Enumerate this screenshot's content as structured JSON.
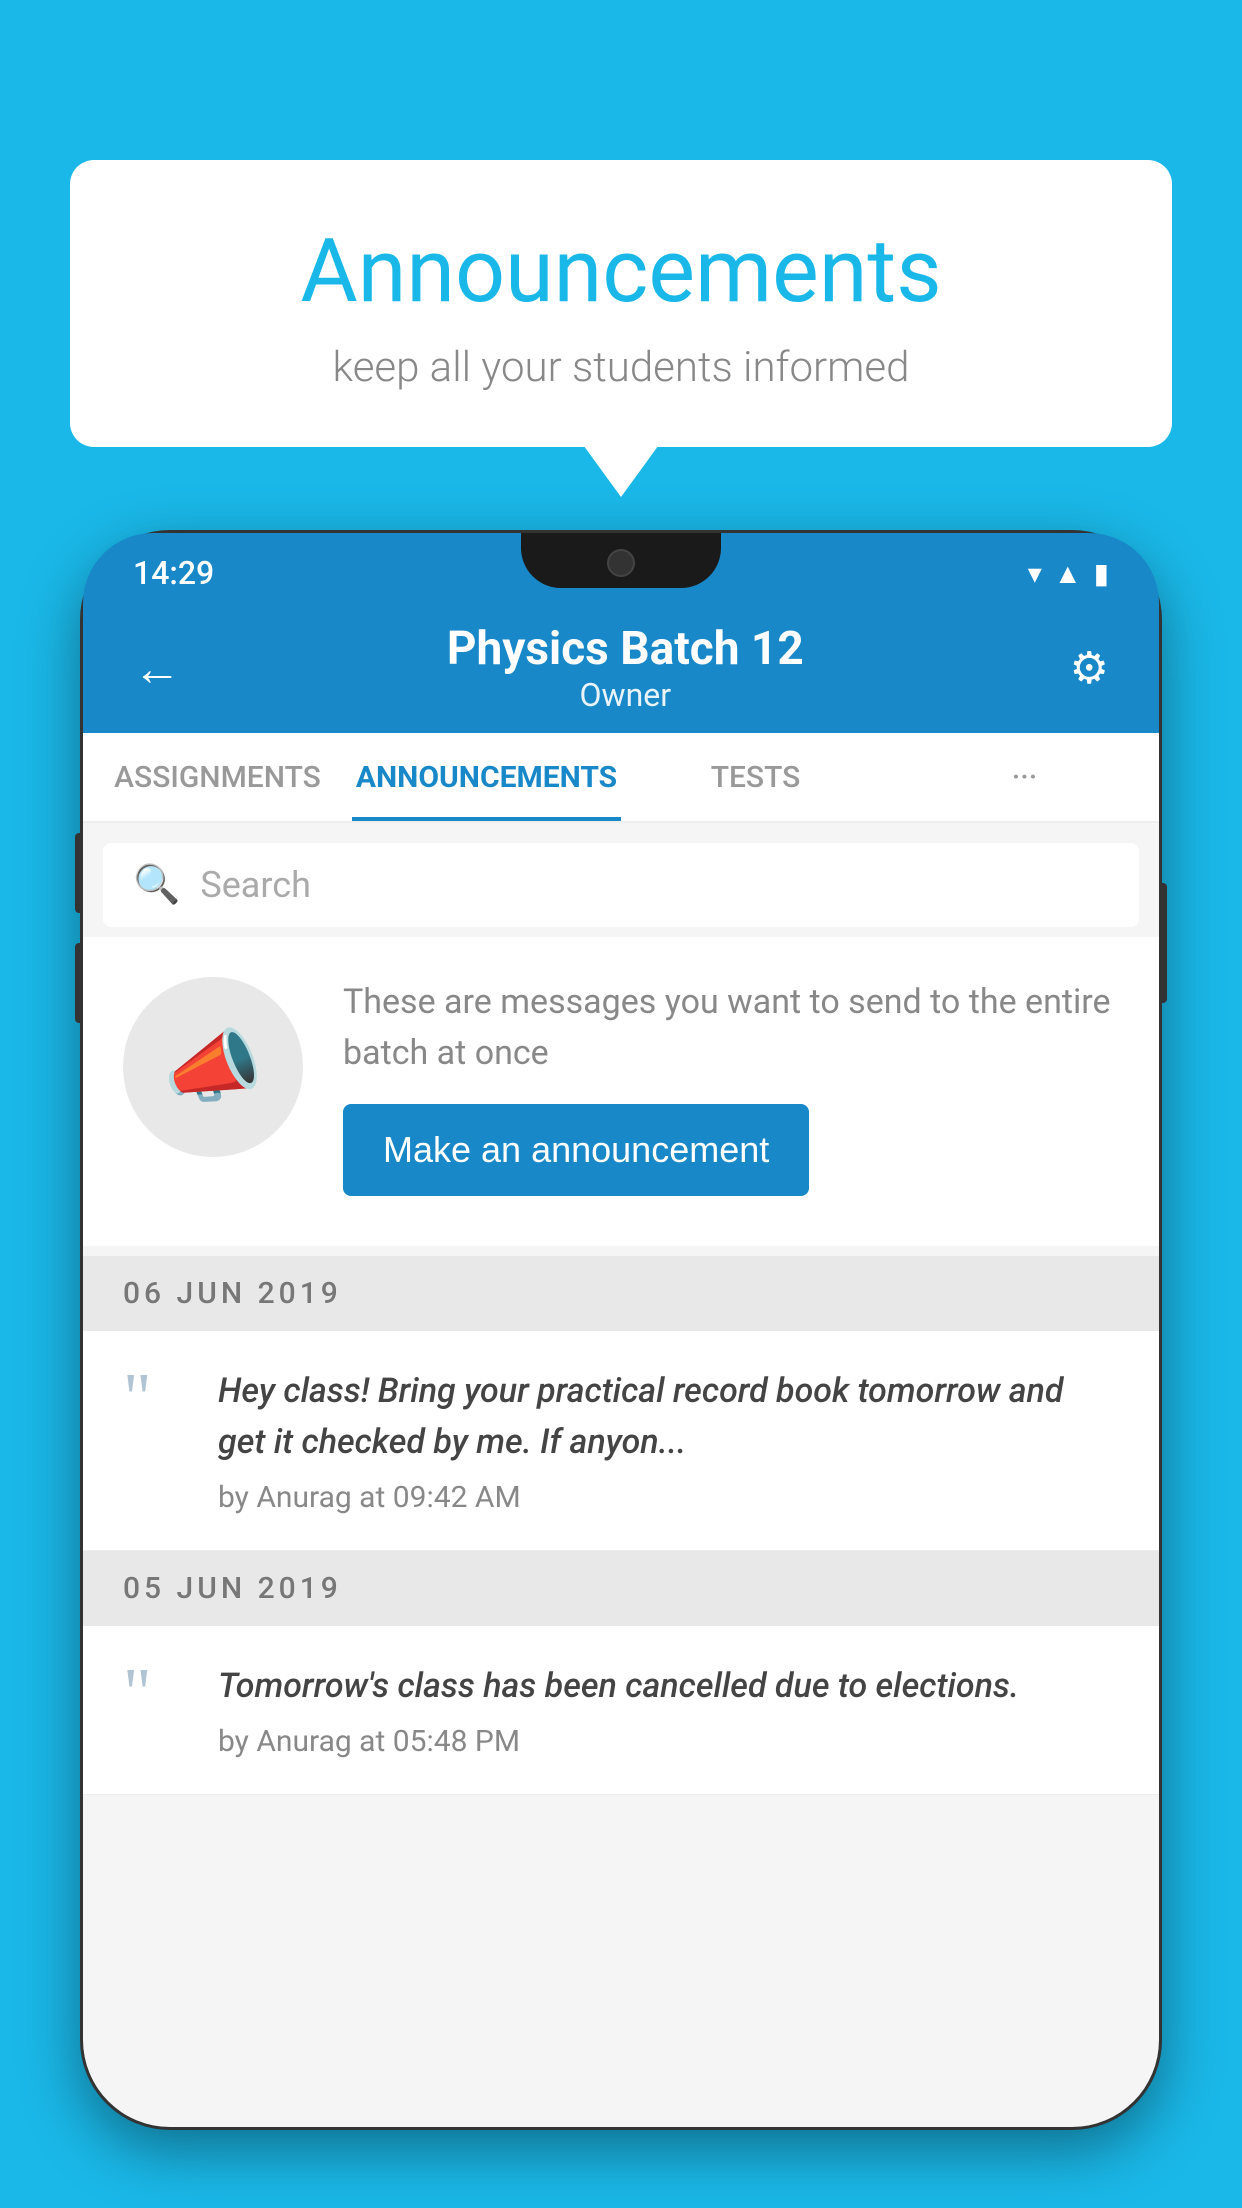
{
  "page": {
    "background_color": "#1ab8e8"
  },
  "speech_bubble": {
    "title": "Announcements",
    "subtitle": "keep all your students informed"
  },
  "status_bar": {
    "time": "14:29"
  },
  "app_bar": {
    "title": "Physics Batch 12",
    "subtitle": "Owner",
    "back_label": "←",
    "settings_label": "⚙"
  },
  "tabs": [
    {
      "label": "ASSIGNMENTS",
      "active": false
    },
    {
      "label": "ANNOUNCEMENTS",
      "active": true
    },
    {
      "label": "TESTS",
      "active": false
    },
    {
      "label": "···",
      "active": false
    }
  ],
  "search": {
    "placeholder": "Search"
  },
  "announcement_prompt": {
    "description": "These are messages you want to send to the entire batch at once",
    "button_label": "Make an announcement"
  },
  "announcements": [
    {
      "date": "06  JUN  2019",
      "message": "Hey class! Bring your practical record book tomorrow and get it checked by me. If anyon...",
      "author": "by Anurag at 09:42 AM"
    },
    {
      "date": "05  JUN  2019",
      "message": "Tomorrow's class has been cancelled due to elections.",
      "author": "by Anurag at 05:48 PM"
    }
  ]
}
